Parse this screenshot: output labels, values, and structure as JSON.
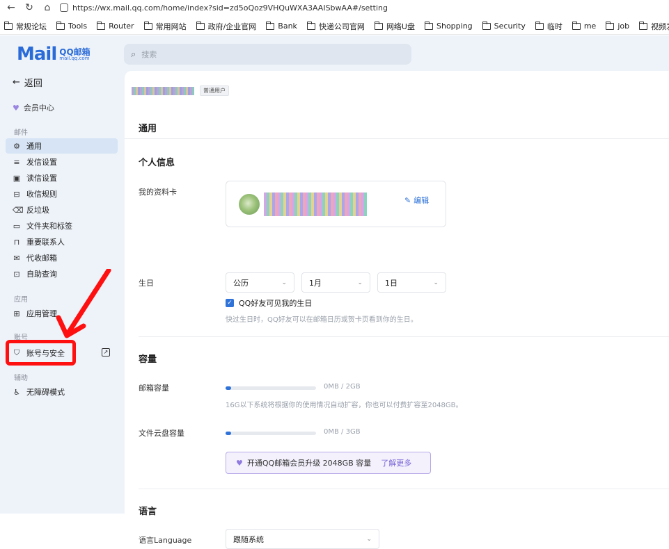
{
  "browser": {
    "url": "https://wx.mail.qq.com/home/index?sid=zd5oQoz9VHQuWXA3AAISbwAA#/setting",
    "bookmarks": [
      "常规论坛",
      "Tools",
      "Router",
      "常用网站",
      "政府/企业官网",
      "Bank",
      "快递公司官网",
      "网络U盘",
      "Shopping",
      "Security",
      "临时",
      "me",
      "job",
      "视频发布"
    ]
  },
  "sidebar": {
    "logo_main": "Mail",
    "logo_cn": "QQ邮箱",
    "logo_domain": "mail.qq.com",
    "back_label": "返回",
    "member_label": "会员中心",
    "sections": {
      "mail": "邮件",
      "app": "应用",
      "account": "账号",
      "assist": "辅助"
    },
    "mail_items": [
      {
        "label": "通用",
        "icon": "gear-icon",
        "active": true
      },
      {
        "label": "发信设置",
        "icon": "send-settings-icon"
      },
      {
        "label": "读信设置",
        "icon": "read-settings-icon"
      },
      {
        "label": "收信规则",
        "icon": "inbox-rules-icon"
      },
      {
        "label": "反垃圾",
        "icon": "trash-icon"
      },
      {
        "label": "文件夹和标签",
        "icon": "folder-icon"
      },
      {
        "label": "重要联系人",
        "icon": "bookmark-icon"
      },
      {
        "label": "代收邮箱",
        "icon": "collect-mail-icon"
      },
      {
        "label": "自助查询",
        "icon": "self-query-icon"
      }
    ],
    "app_item": "应用管理",
    "account_item": "账号与安全",
    "assist_item": "无障碍模式"
  },
  "search": {
    "placeholder": "搜索"
  },
  "content": {
    "user_badge": "普通用户",
    "page_title": "通用",
    "personal_info_title": "个人信息",
    "profile_card_label": "我的资料卡",
    "edit_label": "编辑",
    "birthday_label": "生日",
    "birthday_calendar": "公历",
    "birthday_month": "1月",
    "birthday_day": "1日",
    "birthday_visible_label": "QQ好友可见我的生日",
    "birthday_visible_checked": true,
    "birthday_hint": "快过生日时，QQ好友可以在邮箱日历或贺卡页看到你的生日。",
    "capacity_title": "容量",
    "mail_capacity_label": "邮箱容量",
    "mail_capacity_value": "0MB / 2GB",
    "mail_capacity_fraction": 0.06,
    "capacity_hint": "16G以下系统将根据你的使用情况自动扩容，你也可以付费扩容至2048GB。",
    "cloud_capacity_label": "文件云盘容量",
    "cloud_capacity_value": "0MB / 3GB",
    "cloud_capacity_fraction": 0.06,
    "upgrade_text": "开通QQ邮箱会员升级 2048GB 容量",
    "upgrade_link": "了解更多",
    "language_title": "语言",
    "language_label": "语言Language",
    "language_value": "跟随系统"
  },
  "colors": {
    "accent": "#2f73d9",
    "highlight_red": "#ff1010",
    "member_purple": "#7a66d6"
  }
}
